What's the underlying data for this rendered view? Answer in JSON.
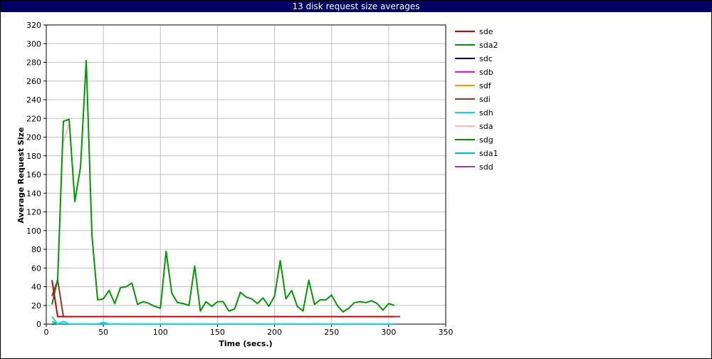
{
  "chart_data": {
    "type": "line",
    "title": "13 disk request size averages",
    "xlabel": "Time (secs.)",
    "ylabel": "Average Request Size",
    "xlim": [
      0,
      350
    ],
    "ylim": [
      0,
      320
    ],
    "xticks": [
      0,
      50,
      100,
      150,
      200,
      250,
      300,
      350
    ],
    "yticks": [
      0,
      20,
      40,
      60,
      80,
      100,
      120,
      140,
      160,
      180,
      200,
      220,
      240,
      260,
      280,
      300,
      320
    ],
    "grid": true,
    "legend_position": "right",
    "series": [
      {
        "name": "sde",
        "color": "#cc0000",
        "x": [
          5,
          10,
          15,
          20,
          305
        ],
        "y": [
          47,
          8,
          8,
          8,
          8
        ]
      },
      {
        "name": "sda2",
        "color": "#009900",
        "x": [
          5,
          10,
          15,
          20,
          25,
          30,
          35,
          40,
          45,
          50,
          55,
          60,
          65,
          70,
          75,
          80,
          85,
          90,
          95,
          100,
          105,
          110,
          115,
          120,
          125,
          130,
          135,
          140,
          145,
          150,
          155,
          160,
          165,
          170,
          175,
          180,
          185,
          190,
          195,
          200,
          205,
          210,
          215,
          220,
          225,
          230,
          235,
          240,
          245,
          250,
          255,
          260,
          265,
          270,
          275,
          280,
          285,
          290,
          295,
          300,
          305
        ],
        "y": [
          21,
          48,
          217,
          219,
          131,
          168,
          282,
          95,
          26,
          27,
          36,
          22,
          39,
          40,
          44,
          21,
          24,
          22,
          19,
          17,
          78,
          33,
          23,
          22,
          20,
          62,
          14,
          24,
          19,
          24,
          24,
          14,
          16,
          34,
          29,
          27,
          22,
          28,
          19,
          30,
          68,
          27,
          36,
          19,
          14,
          47,
          21,
          26,
          26,
          31,
          20,
          13,
          17,
          23,
          24,
          23,
          25,
          22,
          15,
          22,
          20
        ]
      },
      {
        "name": "sdc",
        "color": "#0000aa",
        "x": [
          5,
          305
        ],
        "y": [
          0,
          0
        ]
      },
      {
        "name": "sdb",
        "color": "#ff00ff",
        "x": [
          5,
          305
        ],
        "y": [
          0,
          0
        ]
      },
      {
        "name": "sdf",
        "color": "#ff9900",
        "x": [
          5,
          305
        ],
        "y": [
          0,
          0
        ]
      },
      {
        "name": "sdi",
        "color": "#993333",
        "x": [
          5,
          10,
          15,
          310
        ],
        "y": [
          30,
          47,
          8,
          8
        ]
      },
      {
        "name": "sdh",
        "color": "#00dddd",
        "x": [
          5,
          10,
          15,
          20,
          25,
          45,
          50,
          55,
          305
        ],
        "y": [
          8,
          0,
          3,
          0,
          0,
          0,
          2,
          0,
          0
        ]
      },
      {
        "name": "sda",
        "color": "#ffbbbb",
        "x": [
          15,
          20
        ],
        "y": [
          195,
          214
        ]
      },
      {
        "name": "sdg",
        "color": "#009900",
        "x": [
          5,
          305
        ],
        "y": [
          0,
          0
        ]
      },
      {
        "name": "sda1",
        "color": "#00bbcc",
        "x": [
          5,
          10,
          305
        ],
        "y": [
          3,
          0,
          0
        ]
      },
      {
        "name": "sdd",
        "color": "#994499",
        "x": [
          300,
          310
        ],
        "y": [
          8,
          8
        ]
      }
    ],
    "draw_order": [
      "sdd",
      "sdi",
      "sda",
      "sdc",
      "sdb",
      "sdf",
      "sdg",
      "sda1",
      "sdh",
      "sda2",
      "sde"
    ]
  }
}
